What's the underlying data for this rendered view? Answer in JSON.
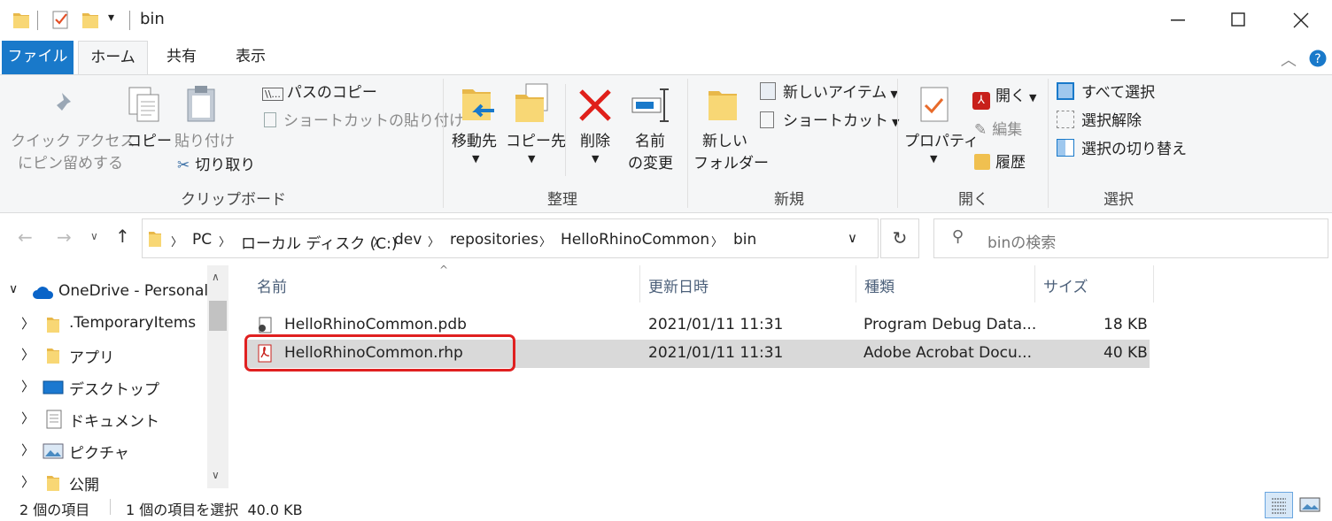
{
  "window": {
    "title": "bin"
  },
  "tabs": {
    "file": "ファイル",
    "home": "ホーム",
    "share": "共有",
    "view": "表示"
  },
  "ribbon": {
    "pin1": "クイック アクセス",
    "pin2": "にピン留めする",
    "copy": "コピー",
    "paste": "貼り付け",
    "copy_path": "パスのコピー",
    "paste_shortcut": "ショートカットの貼り付け",
    "cut": "切り取り",
    "clipboard": "クリップボード",
    "move_to": "移動先",
    "copy_to": "コピー先",
    "delete": "削除",
    "rename1": "名前",
    "rename2": "の変更",
    "organize": "整理",
    "new_folder1": "新しい",
    "new_folder2": "フォルダー",
    "new_item": "新しいアイテム",
    "shortcut": "ショートカット",
    "new_group": "新規",
    "properties": "プロパティ",
    "open": "開く",
    "edit": "編集",
    "history": "履歴",
    "open_group": "開く",
    "select_all": "すべて選択",
    "select_none": "選択解除",
    "invert": "選択の切り替え",
    "select_group": "選択"
  },
  "address": {
    "crumbs": [
      "PC",
      "ローカル ディスク (C:)",
      "dev",
      "repositories",
      "HelloRhinoCommon",
      "bin"
    ],
    "search_placeholder": "binの検索"
  },
  "nav": {
    "items": [
      "OneDrive - Personal",
      ".TemporaryItems",
      "アプリ",
      "デスクトップ",
      "ドキュメント",
      "ピクチャ",
      "公開"
    ]
  },
  "columns": {
    "name": "名前",
    "date": "更新日時",
    "type": "種類",
    "size": "サイズ"
  },
  "files": [
    {
      "name": "HelloRhinoCommon.pdb",
      "date": "2021/01/11 11:31",
      "type": "Program Debug Data...",
      "size": "18 KB"
    },
    {
      "name": "HelloRhinoCommon.rhp",
      "date": "2021/01/11 11:31",
      "type": "Adobe Acrobat Docu...",
      "size": "40 KB"
    }
  ],
  "status": {
    "count": "2 個の項目",
    "selected": "1 個の項目を選択  40.0 KB"
  },
  "colors": {
    "accent": "#1979ca",
    "highlight": "#e02020"
  }
}
